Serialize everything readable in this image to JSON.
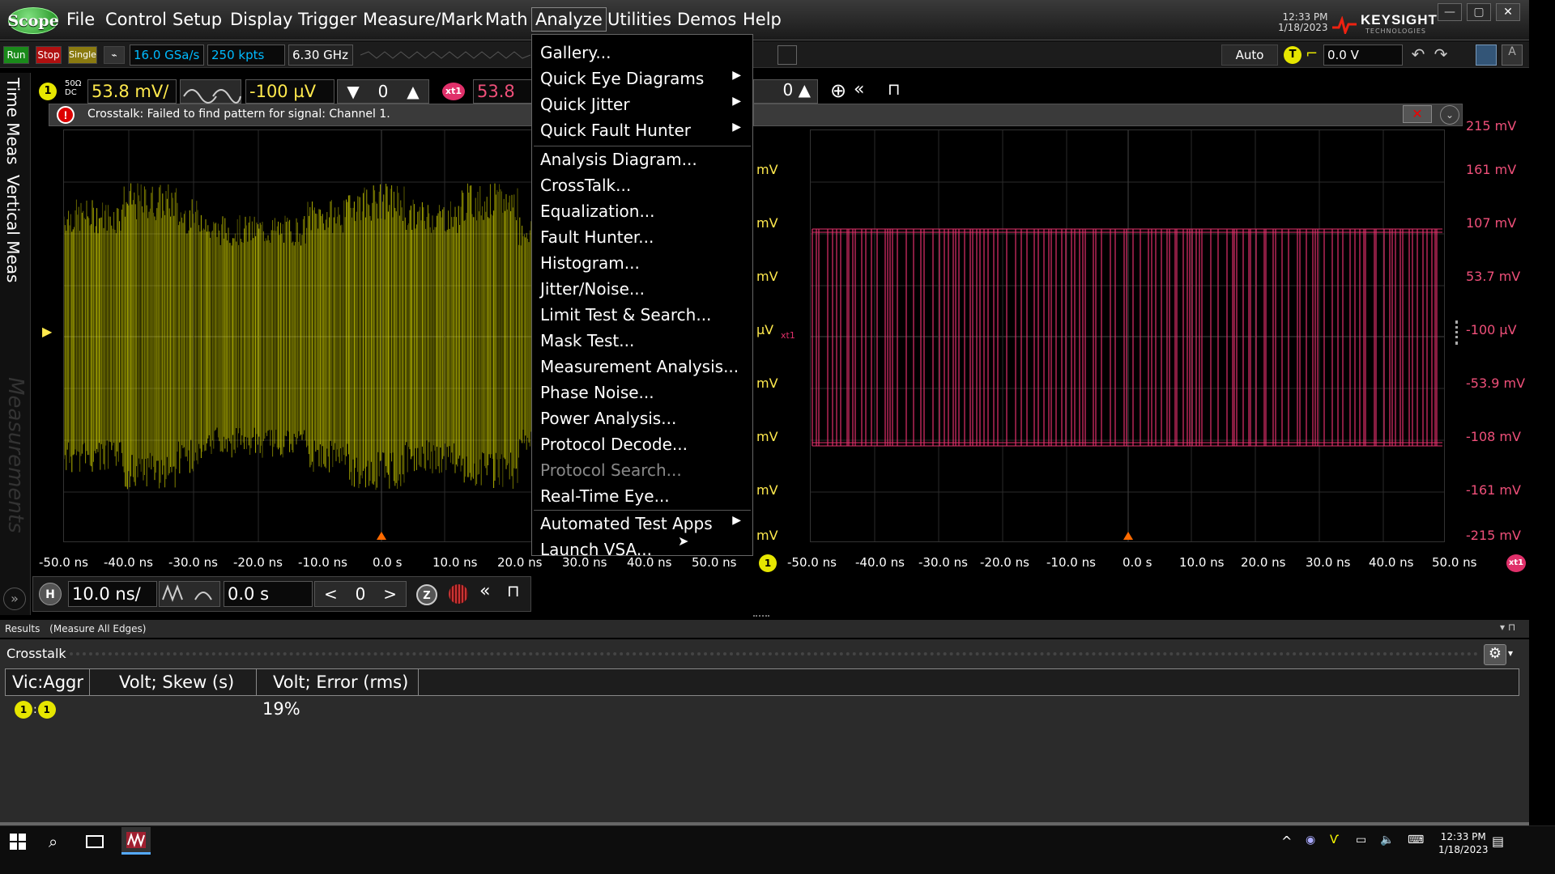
{
  "menubar": {
    "logo": "Scope",
    "items": [
      "File",
      "Control",
      "Setup",
      "Display",
      "Trigger",
      "Measure/Mark",
      "Math",
      "Analyze",
      "Utilities",
      "Demos",
      "Help"
    ],
    "active": "Analyze",
    "time": "12:33 PM",
    "date": "1/18/2023",
    "brand": "KEYSIGHT",
    "brand_sub": "TECHNOLOGIES"
  },
  "toolbar": {
    "run": "Run",
    "stop": "Stop",
    "single": "Single",
    "sample_rate": "16.0 GSa/s",
    "memory": "250 kpts",
    "bandwidth": "6.30 GHz",
    "trigger_mode": "Auto",
    "trigger_icon": "T",
    "trigger_level": "0.0 V"
  },
  "sidebar": {
    "tab1": "Time Meas",
    "tab2": "Vertical Meas",
    "tab3": "Measurements"
  },
  "channel1": {
    "num": "1",
    "impedance": "50Ω",
    "coupling": "DC",
    "scale": "53.8 mV/",
    "offset": "-100 µV"
  },
  "xtalk": {
    "label": "xt1",
    "scale": "53.8 m"
  },
  "error": {
    "icon": "!",
    "text": "Crosstalk: Failed to find pattern for signal: Channel 1."
  },
  "plot_left": {
    "x_ticks": [
      "-50.0 ns",
      "-40.0 ns",
      "-30.0 ns",
      "-20.0 ns",
      "-10.0 ns",
      "0.0 s",
      "10.0 ns",
      "20.0 ns",
      "30.0 ns",
      "40.0 ns",
      "50.0 ns"
    ],
    "y_partial": [
      "mV",
      "mV",
      "mV",
      "µV",
      "mV",
      "mV",
      "mV",
      "mV"
    ]
  },
  "plot_right": {
    "x_ticks": [
      "-50.0 ns",
      "-40.0 ns",
      "-30.0 ns",
      "-20.0 ns",
      "-10.0 ns",
      "0.0 s",
      "10.0 ns",
      "20.0 ns",
      "30.0 ns",
      "40.0 ns",
      "50.0 ns"
    ],
    "y_ticks": [
      "215 mV",
      "161 mV",
      "107 mV",
      "53.7 mV",
      "-100 µV",
      "-53.9 mV",
      "-108 mV",
      "-161 mV",
      "-215 mV"
    ],
    "marker": "xt1"
  },
  "analyze_menu": {
    "items": [
      {
        "label": "Gallery...",
        "submenu": false,
        "enabled": true
      },
      {
        "label": "Quick Eye Diagrams",
        "submenu": true,
        "enabled": true
      },
      {
        "label": "Quick Jitter",
        "submenu": true,
        "enabled": true
      },
      {
        "label": "Quick Fault Hunter",
        "submenu": true,
        "enabled": true
      },
      {
        "label": "Analysis Diagram...",
        "submenu": false,
        "enabled": true
      },
      {
        "label": "CrossTalk...",
        "submenu": false,
        "enabled": true
      },
      {
        "label": "Equalization...",
        "submenu": false,
        "enabled": true
      },
      {
        "label": "Fault Hunter...",
        "submenu": false,
        "enabled": true
      },
      {
        "label": "Histogram...",
        "submenu": false,
        "enabled": true
      },
      {
        "label": "Jitter/Noise...",
        "submenu": false,
        "enabled": true
      },
      {
        "label": "Limit Test & Search...",
        "submenu": false,
        "enabled": true
      },
      {
        "label": "Mask Test...",
        "submenu": false,
        "enabled": true
      },
      {
        "label": "Measurement Analysis...",
        "submenu": false,
        "enabled": true
      },
      {
        "label": "Phase Noise...",
        "submenu": false,
        "enabled": true
      },
      {
        "label": "Power Analysis...",
        "submenu": false,
        "enabled": true
      },
      {
        "label": "Protocol Decode...",
        "submenu": false,
        "enabled": true
      },
      {
        "label": "Protocol Search...",
        "submenu": false,
        "enabled": false
      },
      {
        "label": "Real-Time Eye...",
        "submenu": false,
        "enabled": true
      },
      {
        "label": "Automated Test Apps",
        "submenu": true,
        "enabled": true
      },
      {
        "label": "Launch VSA...",
        "submenu": false,
        "enabled": true
      }
    ]
  },
  "horizontal": {
    "h": "H",
    "scale": "10.0 ns/",
    "position": "0.0 s",
    "zoom": "Z"
  },
  "results": {
    "header": "Results",
    "mode": "(Measure All Edges)",
    "section": "Crosstalk",
    "columns": [
      "Vic:Aggr",
      "Volt; Skew (s)",
      "Volt; Error (rms)"
    ],
    "row_vic": "1",
    "row_aggr": "1",
    "row_error": "19%"
  },
  "taskbar": {
    "time": "12:33 PM",
    "date": "1/18/2023"
  },
  "colors": {
    "ch1": "#e6e600",
    "xtalk": "#e0306a",
    "accent": "#0bf"
  }
}
